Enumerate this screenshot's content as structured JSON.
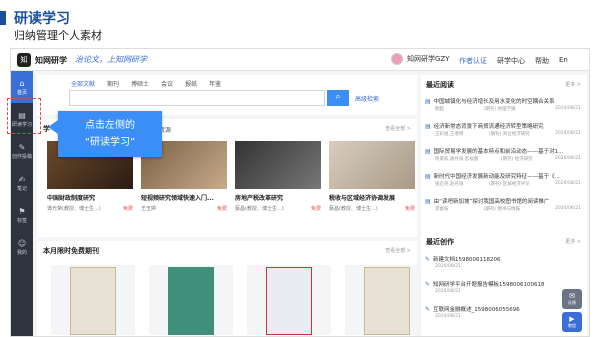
{
  "slide": {
    "title": "研读学习",
    "subtitle": "归纳管理个人素材"
  },
  "topbar": {
    "logo": "知",
    "brand": "知网研学",
    "slogan": "治论文，上知网研学",
    "user": "知网研学GZY",
    "links": [
      "作者认证",
      "研学中心",
      "帮助",
      "En"
    ]
  },
  "sidenav": [
    {
      "label": "首页",
      "icon": "⌂"
    },
    {
      "label": "研读学习",
      "icon": "▤"
    },
    {
      "label": "创作投稿",
      "icon": "✎"
    },
    {
      "label": "笔记",
      "icon": "✍"
    },
    {
      "label": "标签",
      "icon": "⚑"
    },
    {
      "label": "我的",
      "icon": "☺"
    }
  ],
  "search": {
    "tabs": [
      "全部文献",
      "期刊",
      "博硕士",
      "会议",
      "报纸",
      "年鉴"
    ],
    "button": "⌕",
    "advanced": "高级检索"
  },
  "section1": {
    "title": "学",
    "tab": "研资源",
    "more": "查看全部 >",
    "books": [
      {
        "title": "中国财政制度研究",
        "author": "谭光荣(教授、博士生...)",
        "price": "免费"
      },
      {
        "title": "短视频研究领域快速入门...",
        "author": "王玉婷",
        "price": "免费"
      },
      {
        "title": "房地产税改革研究",
        "author": "蔡昌(教授、博士生...)",
        "price": "免费"
      },
      {
        "title": "税收与区域经济协调发展",
        "author": "蔡昌(教授、博士生...)",
        "price": "免费"
      }
    ]
  },
  "section2": {
    "title": "本月限时免费期刊",
    "more": "查看全部 >"
  },
  "recent_reading": {
    "title": "最近阅读",
    "more": "更多 >",
    "items": [
      {
        "title": "中国城镇化与经济增长及用水变化的时空耦合关系",
        "source": "鲍超",
        "type": "(期刊) 地理学报",
        "date": "2020/08/21"
      },
      {
        "title": "经济新常态背景下商贸流通经济转型策略研究",
        "source": "王彩姐,王增博",
        "type": "(期刊) 商业经济研究",
        "date": "2020/08/21"
      },
      {
        "title": "国际贸易学发展的基本特点和前沿动态——基于对1...",
        "source": "佟家栋,谢丹阳,彭福嘉",
        "type": "(期刊) 经济研究",
        "date": "2020/08/21"
      },
      {
        "title": "新时代中国经济发展新动能及研究特征——基于《...",
        "source": "张启英,赵丹阳",
        "type": "(期刊) 区域经济评论",
        "date": "2020/08/21"
      },
      {
        "title": "由“读吧新加坡”探讨我国高校图书馆的阅读推广",
        "source": "李素枝",
        "type": "(期刊) 图书与情报",
        "date": "2020/08/21"
      }
    ]
  },
  "recent_writing": {
    "title": "最近创作",
    "more": "更多 >",
    "items": [
      {
        "title": "新建文档1598006118206",
        "date": "2020/08/21"
      },
      {
        "title": "知网研学平台开题报告模板1598006100618",
        "date": "2020/08/21"
      },
      {
        "title": "互联网金融概述_1598006055696",
        "date": "2020/08/21"
      }
    ]
  },
  "floating": [
    {
      "label": "反馈",
      "icon": "✉"
    },
    {
      "label": "教程",
      "icon": "▶"
    }
  ],
  "callout": {
    "line1": "点击左侧的",
    "line2": "“研读学习”"
  }
}
